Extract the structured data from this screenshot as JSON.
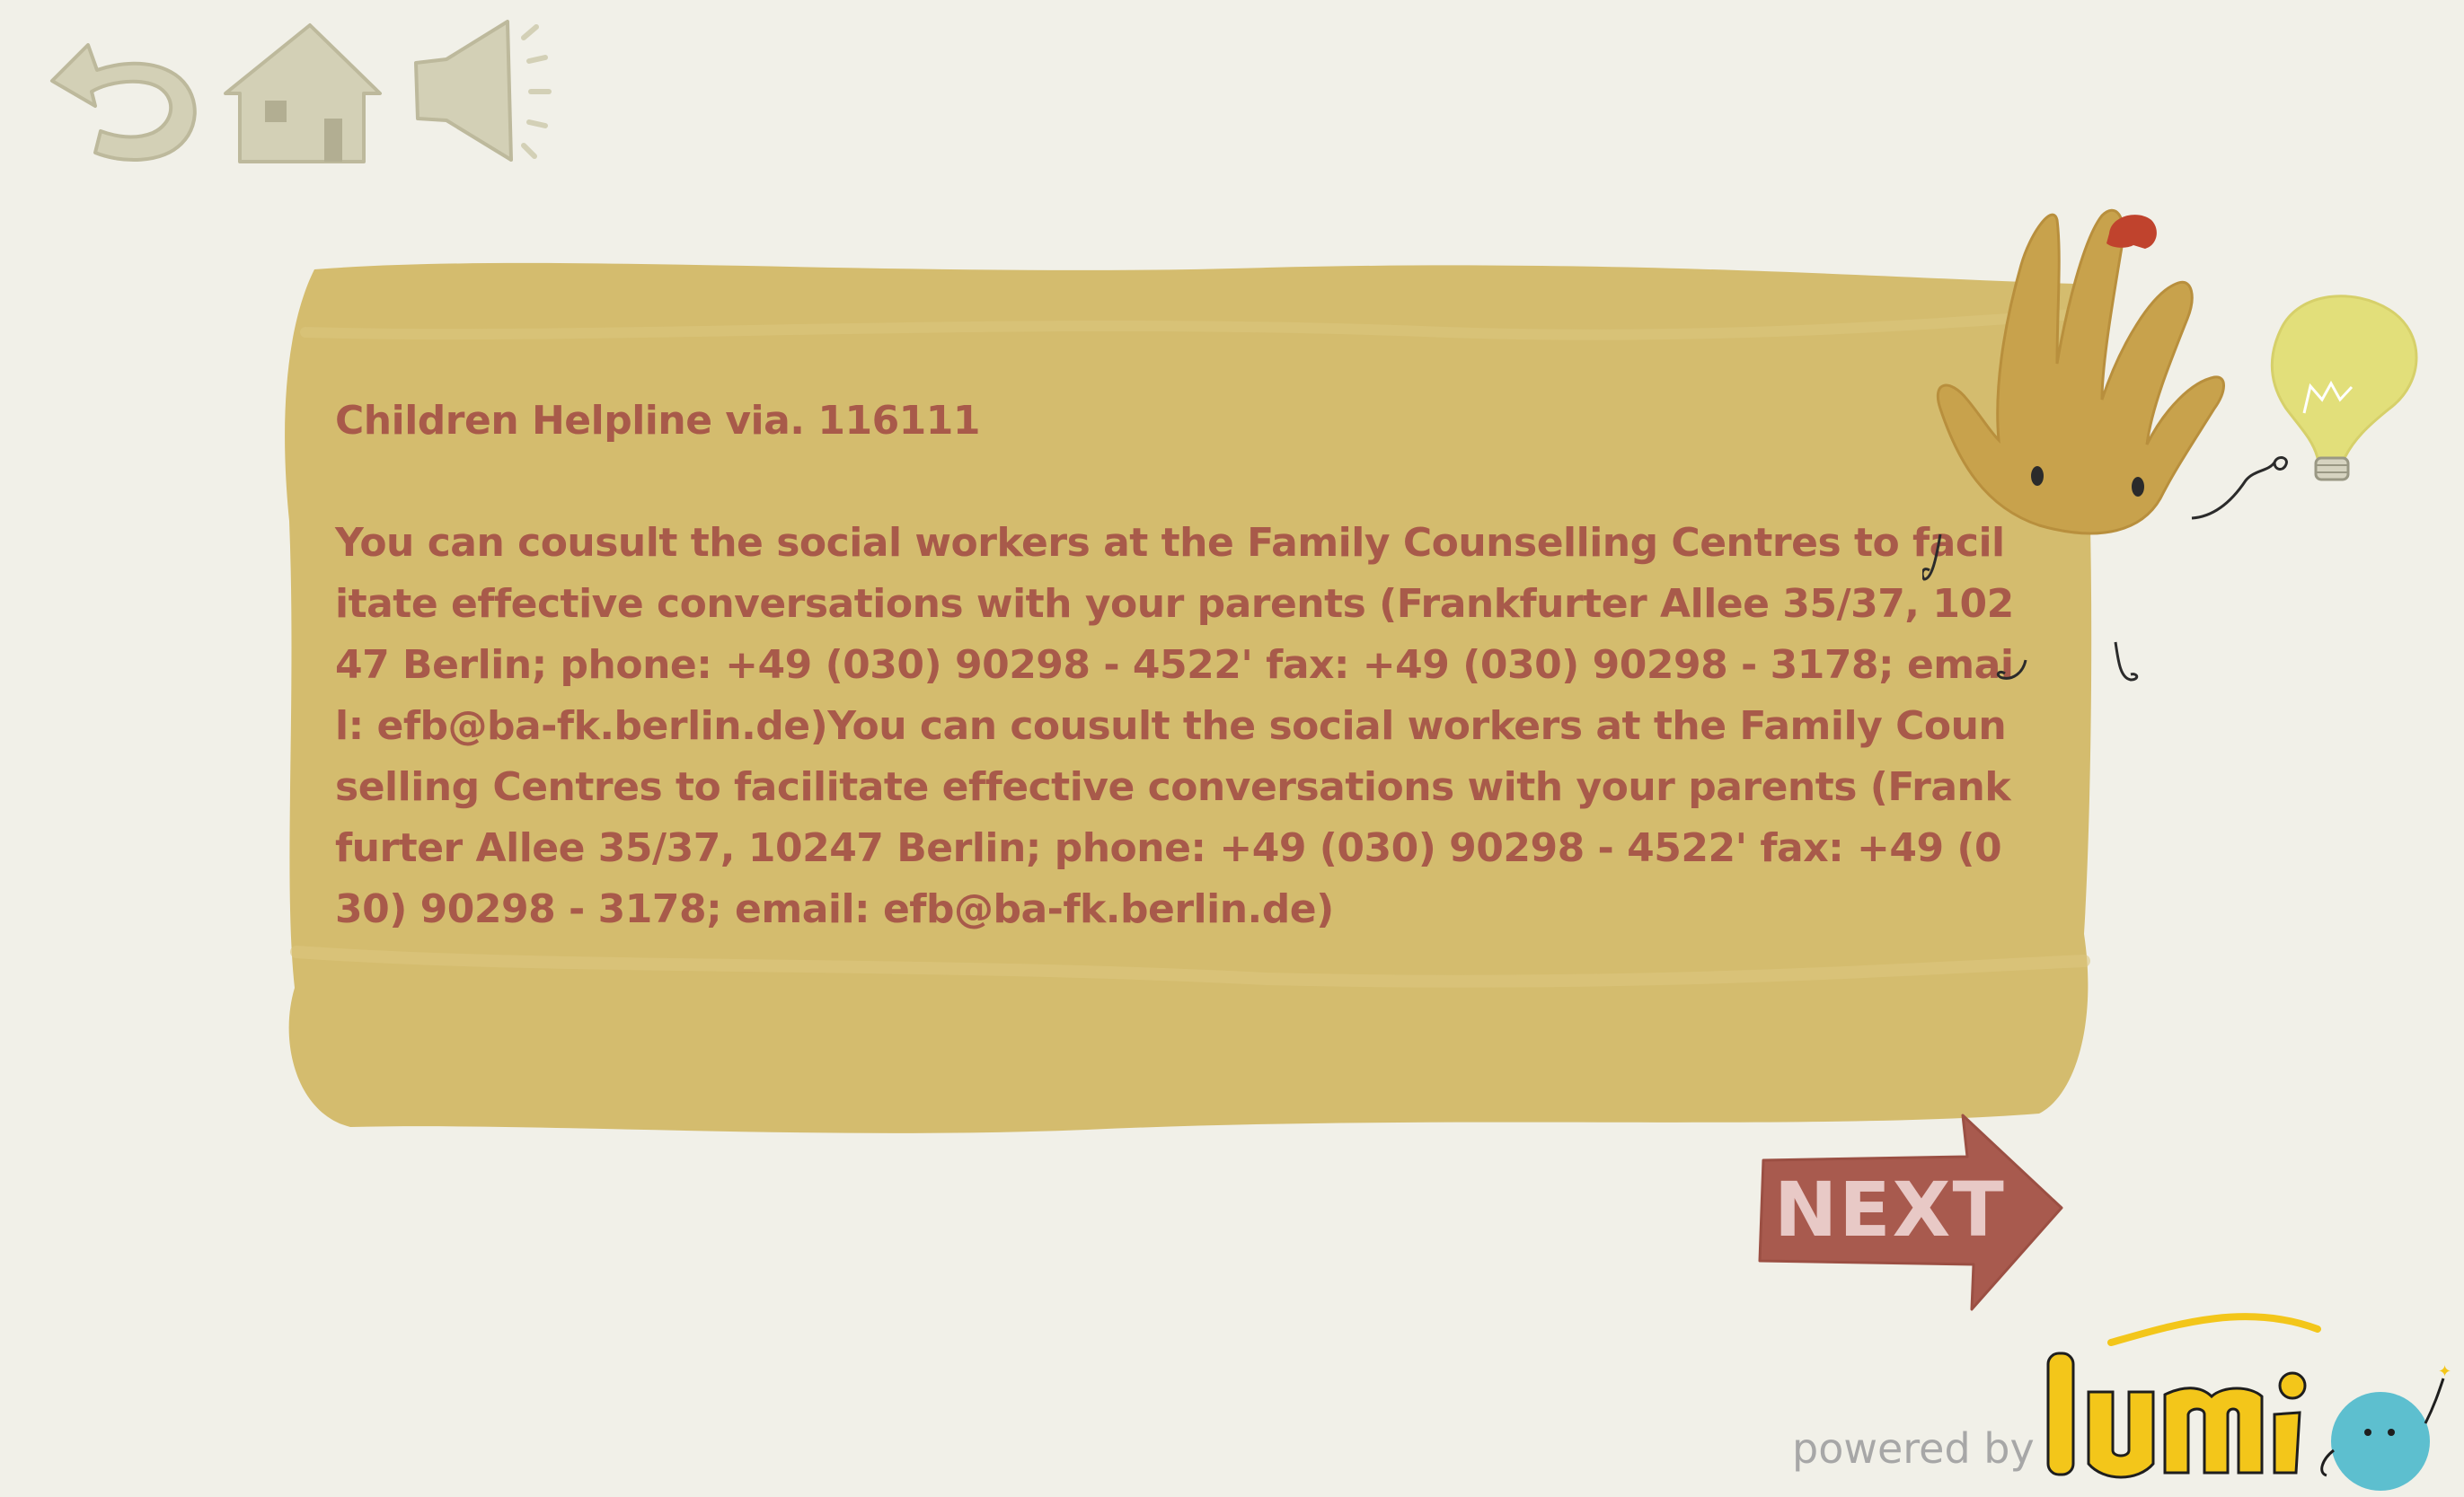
{
  "toolbar": {
    "back_icon": "undo-arrow-icon",
    "home_icon": "house-icon",
    "sound_icon": "speaker-icon"
  },
  "card": {
    "title": "Children Helpline via. 116111",
    "body": "You can cousult the social workers at the Family Counselling Centres to facilitate effective conversations with your parents (Frankfurter Allee 35/37, 10247 Berlin; phone: +49 (030) 90298 - 4522' fax: +49 (030) 90298 - 3178; email: efb@ba-fk.berlin.de)You can cousult the social workers at the Family Counselling Centres to facilitate effective conversations with your parents (Frankfurter Allee 35/37, 10247 Berlin; phone: +49 (030) 90298 - 4522' fax: +49 (030) 90298 - 3178; email: efb@ba-fk.berlin.de)"
  },
  "mascot": {
    "icon": "hand-mascot-with-lightbulb-icon"
  },
  "next_button": {
    "label": "NEXT"
  },
  "footer": {
    "powered_by": "powered by",
    "logo_text": "lumi"
  },
  "colors": {
    "background": "#f1f0e8",
    "card": "#d4bc6e",
    "text": "#a85a4a",
    "icon": "#d3d0b6",
    "next_button": "#a85a4e",
    "lumi_yellow": "#f3c61a",
    "lumi_blue": "#5dbfcf"
  }
}
